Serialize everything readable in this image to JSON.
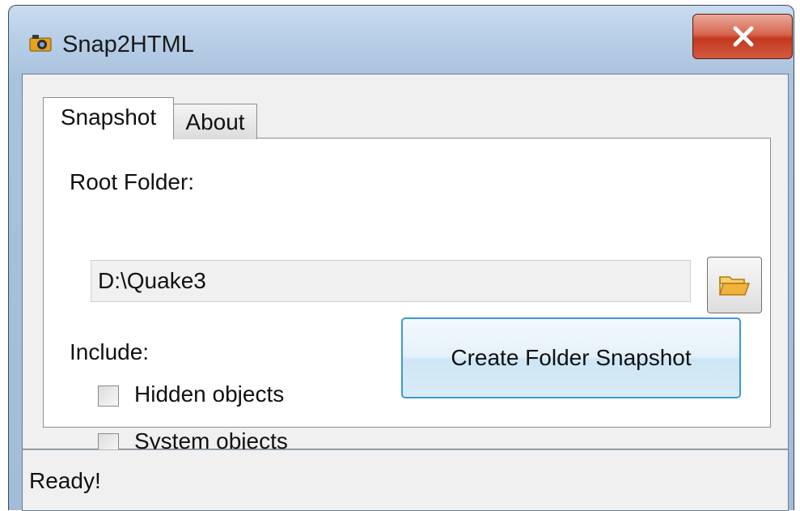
{
  "window": {
    "title": "Snap2HTML",
    "icon": "camera-icon",
    "close_icon": "close-icon"
  },
  "tabs": [
    {
      "label": "Snapshot",
      "selected": true
    },
    {
      "label": "About",
      "selected": false
    }
  ],
  "root_folder": {
    "label": "Root Folder:",
    "value": "D:\\Quake3",
    "browse_icon": "folder-open-icon"
  },
  "include": {
    "label": "Include:",
    "options": [
      {
        "label": "Hidden objects",
        "checked": false
      },
      {
        "label": "System objects",
        "checked": false
      }
    ]
  },
  "actions": {
    "create_label": "Create Folder Snapshot"
  },
  "status": {
    "text": "Ready!"
  },
  "colors": {
    "accent": "#3c9ad0",
    "close_button": "#c2391f",
    "folder": "#f2b33d"
  }
}
